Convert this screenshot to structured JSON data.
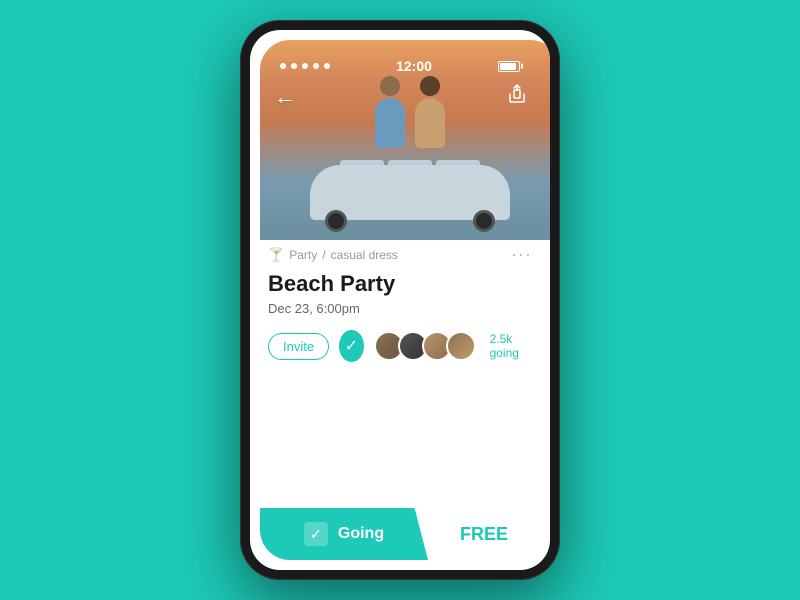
{
  "background_color": "#1dc9b7",
  "status_bar": {
    "time": "12:00"
  },
  "event": {
    "category": "Party",
    "dress_code": "casual dress",
    "title": "Beach Party",
    "date": "Dec 23, 6:00pm",
    "attendees_count": "2.5k going",
    "invite_label": "Invite",
    "going_label": "Going",
    "free_label": "FREE",
    "more_options": "···"
  },
  "nav": {
    "back_icon": "←",
    "share_icon": "⬆"
  },
  "avatars": [
    {
      "id": 1,
      "class": "avatar-1"
    },
    {
      "id": 2,
      "class": "avatar-2"
    },
    {
      "id": 3,
      "class": "avatar-3"
    },
    {
      "id": 4,
      "class": "avatar-4"
    }
  ]
}
